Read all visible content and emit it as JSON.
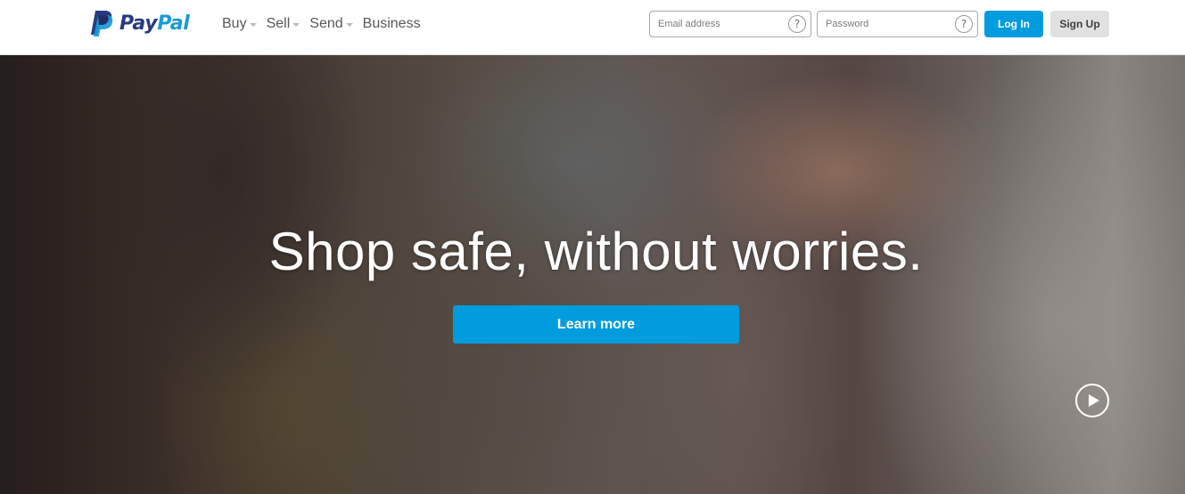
{
  "brand": {
    "logo_pay": "Pay",
    "logo_pal": "Pal",
    "colors": {
      "dark_blue": "#253b80",
      "light_blue": "#179bd7",
      "accent": "#009cde"
    }
  },
  "nav": {
    "items": [
      {
        "label": "Buy",
        "has_dropdown": true
      },
      {
        "label": "Sell",
        "has_dropdown": true
      },
      {
        "label": "Send",
        "has_dropdown": true
      },
      {
        "label": "Business",
        "has_dropdown": false
      }
    ]
  },
  "login": {
    "email_placeholder": "Email address",
    "email_value": "",
    "email_help": "?",
    "password_placeholder": "Password",
    "password_value": "",
    "password_help": "?",
    "login_label": "Log In",
    "signup_label": "Sign Up"
  },
  "hero": {
    "headline": "Shop safe, without worries.",
    "cta_label": "Learn more",
    "play_icon": "play-icon"
  }
}
